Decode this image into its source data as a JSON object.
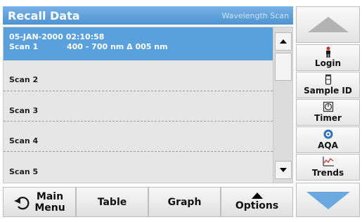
{
  "header": {
    "title": "Recall Data",
    "mode": "Wavelength Scan"
  },
  "list": {
    "selected": {
      "datetime": "05-JAN-2000  02:10:58",
      "name": "Scan 1",
      "range": "400 - 700 nm Δ 005 nm"
    },
    "items": [
      "Scan 2",
      "Scan 3",
      "Scan 4",
      "Scan 5"
    ]
  },
  "side_buttons": [
    {
      "label": "Login",
      "icon": "person-icon"
    },
    {
      "label": "Sample ID",
      "icon": "sample-vial-icon"
    },
    {
      "label": "Timer",
      "icon": "timer-icon"
    },
    {
      "label": "AQA",
      "icon": "aqa-icon"
    },
    {
      "label": "Trends",
      "icon": "trends-icon"
    }
  ],
  "bottom": {
    "main_line1": "Main",
    "main_line2": "Menu",
    "table": "Table",
    "graph": "Graph",
    "options": "Options"
  },
  "colors": {
    "header": "#4e93d2",
    "selected_row": "#5aa0dc",
    "arrow_blue": "#6aa8df"
  }
}
